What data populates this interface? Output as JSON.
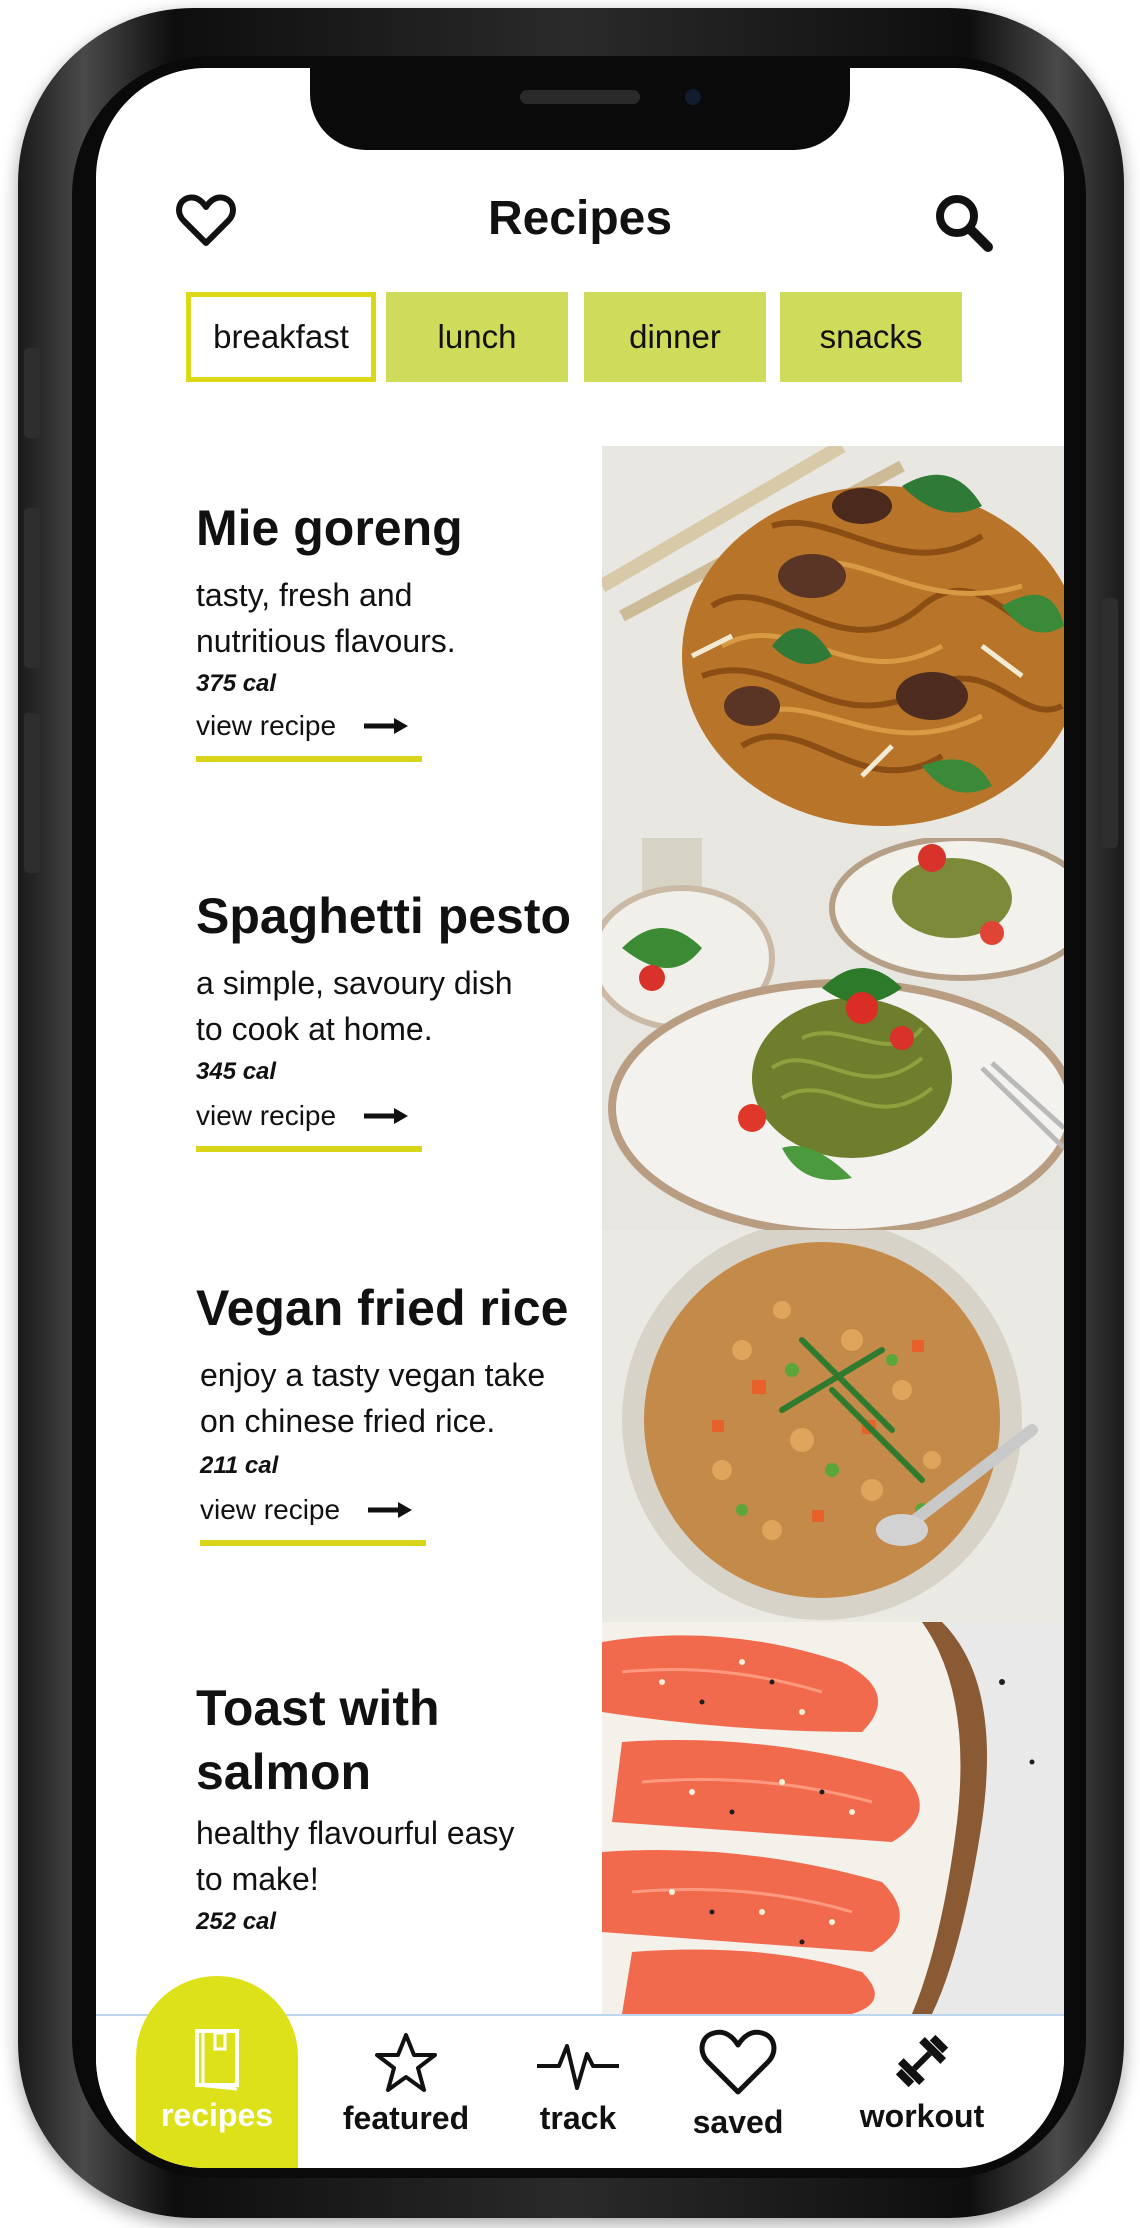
{
  "header": {
    "title": "Recipes"
  },
  "tabs": [
    {
      "label": "breakfast",
      "active": true
    },
    {
      "label": "lunch",
      "active": false
    },
    {
      "label": "dinner",
      "active": false
    },
    {
      "label": "snacks",
      "active": false
    }
  ],
  "recipes": [
    {
      "name": "Mie goreng",
      "desc": "tasty, fresh and nutritious flavours.",
      "cal": "375 cal",
      "link": "view recipe"
    },
    {
      "name": "Spaghetti pesto",
      "desc": "a simple, savoury dish to cook at home.",
      "cal": "345 cal",
      "link": "view recipe"
    },
    {
      "name": "Vegan fried rice",
      "desc": "enjoy a tasty vegan take on chinese fried rice.",
      "cal": "211 cal",
      "link": "view recipe"
    },
    {
      "name_line1": "Toast with",
      "name_line2": "salmon",
      "desc": "healthy flavourful easy to make!",
      "cal": "252 cal"
    }
  ],
  "nav": [
    {
      "label": "recipes",
      "icon": "book-icon",
      "active": true
    },
    {
      "label": "featured",
      "icon": "star-icon"
    },
    {
      "label": "track",
      "icon": "heartbeat-icon"
    },
    {
      "label": "saved",
      "icon": "heart-icon"
    },
    {
      "label": "workout",
      "icon": "dumbbell-icon"
    }
  ],
  "colors": {
    "accent": "#dce11a",
    "tab_bg": "#cfdb5a",
    "underline": "#d9d61a",
    "text": "#111111"
  }
}
